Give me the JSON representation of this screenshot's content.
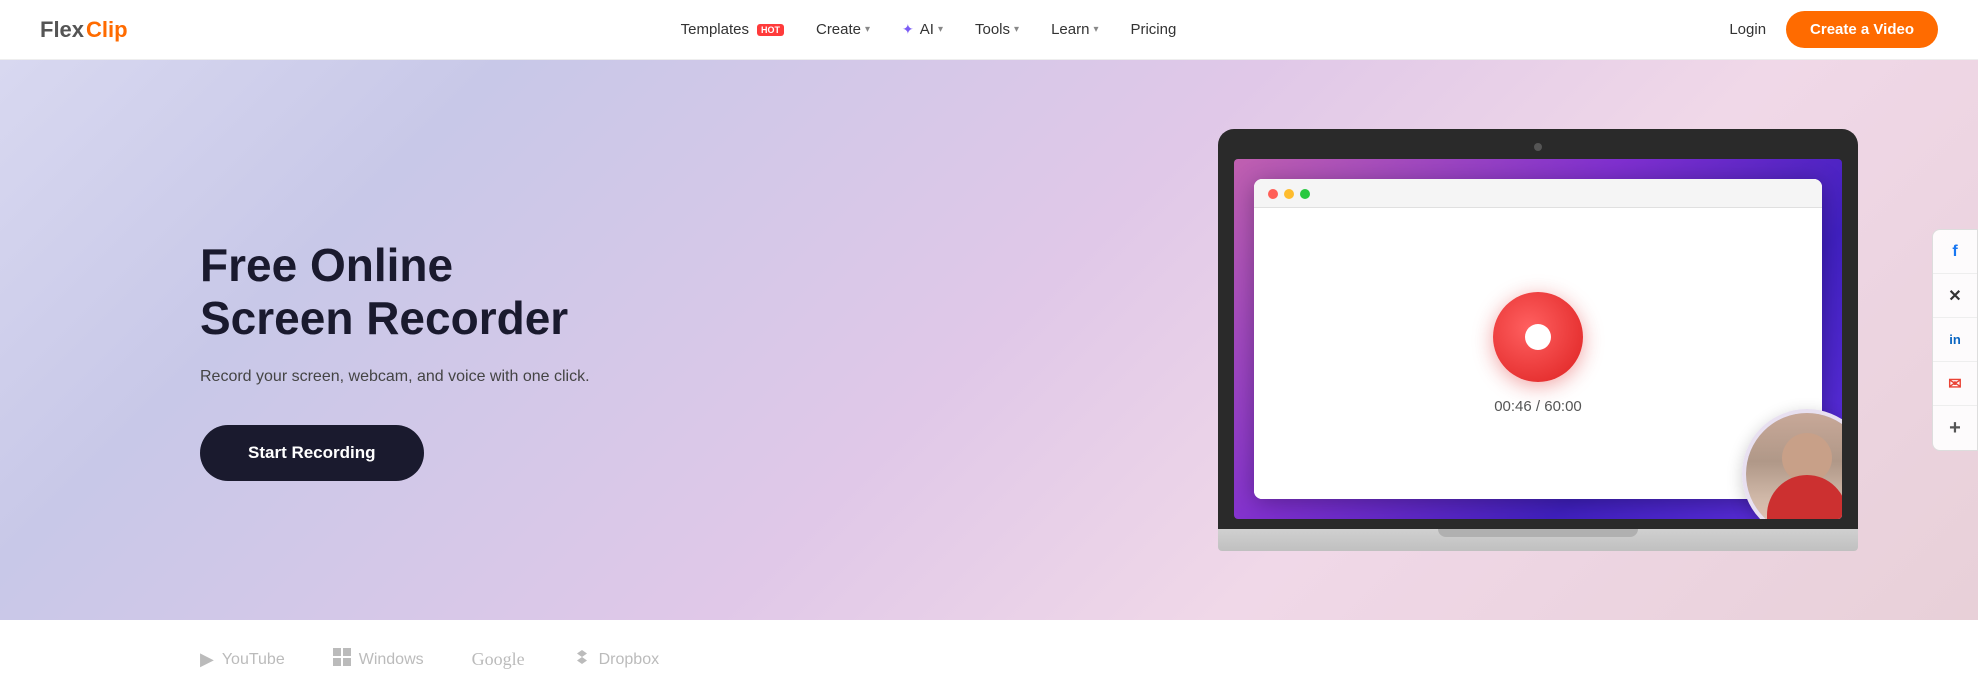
{
  "logo": {
    "flex": "Flex",
    "clip": "Clip"
  },
  "navbar": {
    "templates_label": "Templates",
    "templates_hot": "HOT",
    "create_label": "Create",
    "ai_label": "AI",
    "tools_label": "Tools",
    "learn_label": "Learn",
    "pricing_label": "Pricing",
    "login_label": "Login",
    "create_video_label": "Create a Video"
  },
  "hero": {
    "title": "Free Online Screen Recorder",
    "subtitle": "Record your screen, webcam, and voice with one click.",
    "cta_label": "Start Recording",
    "timer": "00:46 / 60:00"
  },
  "partners": [
    {
      "name": "YouTube",
      "icon": "▶"
    },
    {
      "name": "Windows",
      "icon": "⊞"
    },
    {
      "name": "Google",
      "icon": ""
    },
    {
      "name": "Dropbox",
      "icon": "❖"
    }
  ],
  "social": [
    {
      "name": "facebook",
      "label": "f"
    },
    {
      "name": "twitter",
      "label": "𝕏"
    },
    {
      "name": "linkedin",
      "label": "in"
    },
    {
      "name": "email",
      "label": "✉"
    },
    {
      "name": "more",
      "label": "+"
    }
  ]
}
